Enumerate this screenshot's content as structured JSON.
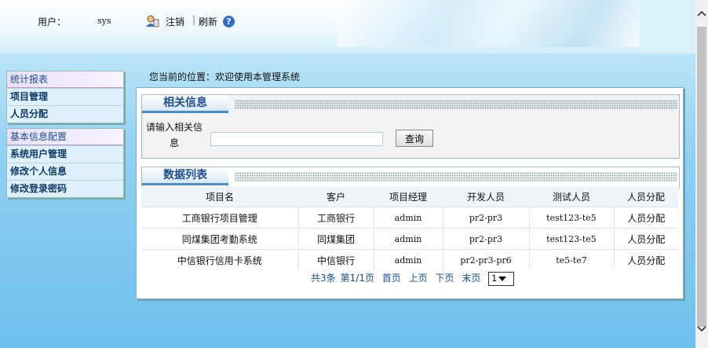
{
  "header": {
    "user_label": "用户：",
    "user_value": "sys",
    "logout": "注销",
    "separator": "|",
    "refresh": "刷新",
    "help": "?"
  },
  "sidebar": {
    "groups": [
      {
        "head": "统计报表",
        "items": [
          "项目管理",
          "人员分配"
        ]
      },
      {
        "head": "基本信息配置",
        "items": [
          "系统用户管理",
          "修改个人信息",
          "修改登录密码"
        ]
      }
    ]
  },
  "breadcrumb": "您当前的位置：欢迎使用本管理系统",
  "search": {
    "title": "相关信息",
    "label_line1": "请输入相关信",
    "label_line2": "息",
    "input_value": "",
    "button": "查询"
  },
  "list": {
    "title": "数据列表",
    "columns": [
      "项目名",
      "客户",
      "项目经理",
      "开发人员",
      "测试人员",
      "人员分配"
    ],
    "rows": [
      [
        "工商银行项目管理",
        "工商银行",
        "admin",
        "pr2-pr3",
        "test123-te5",
        "人员分配"
      ],
      [
        "同煤集团考勤系统",
        "同煤集团",
        "admin",
        "pr2-pr3",
        "test123-te5",
        "人员分配"
      ],
      [
        "中信银行信用卡系统",
        "中信银行",
        "admin",
        "pr2-pr3-pr6",
        "te5-te7",
        "人员分配"
      ]
    ]
  },
  "pager": {
    "total": "共3条",
    "page_info": "第1/1页",
    "first": "首页",
    "prev": "上页",
    "next": "下页",
    "last": "末页",
    "selected_page": "1"
  }
}
